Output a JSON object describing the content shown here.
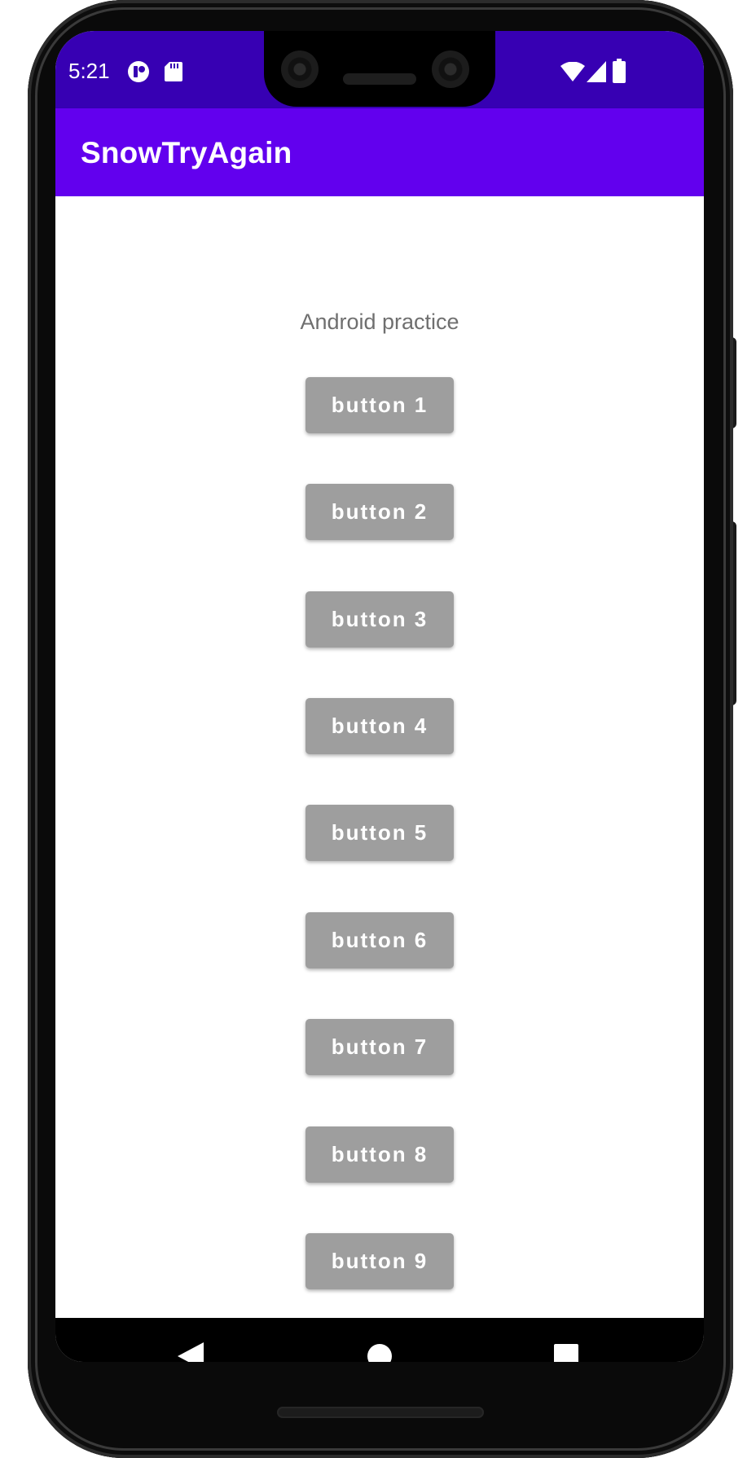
{
  "status_bar": {
    "time": "5:21",
    "icons": [
      "app-notification-icon",
      "sd-card-icon",
      "wifi-icon",
      "cellular-signal-icon",
      "battery-icon"
    ]
  },
  "app_bar": {
    "title": "SnowTryAgain",
    "color": "#6200ee",
    "status_color": "#3700b3"
  },
  "content": {
    "heading": "Android practice",
    "buttons": [
      {
        "label": "button 1"
      },
      {
        "label": "button 2"
      },
      {
        "label": "button 3"
      },
      {
        "label": "button 4"
      },
      {
        "label": "button 5"
      },
      {
        "label": "button 6"
      },
      {
        "label": "button 7"
      },
      {
        "label": "button 8"
      },
      {
        "label": "button 9"
      }
    ],
    "button_color": "#9e9e9e"
  },
  "nav_bar": {
    "icons": [
      "back-icon",
      "home-icon",
      "recents-icon"
    ]
  }
}
